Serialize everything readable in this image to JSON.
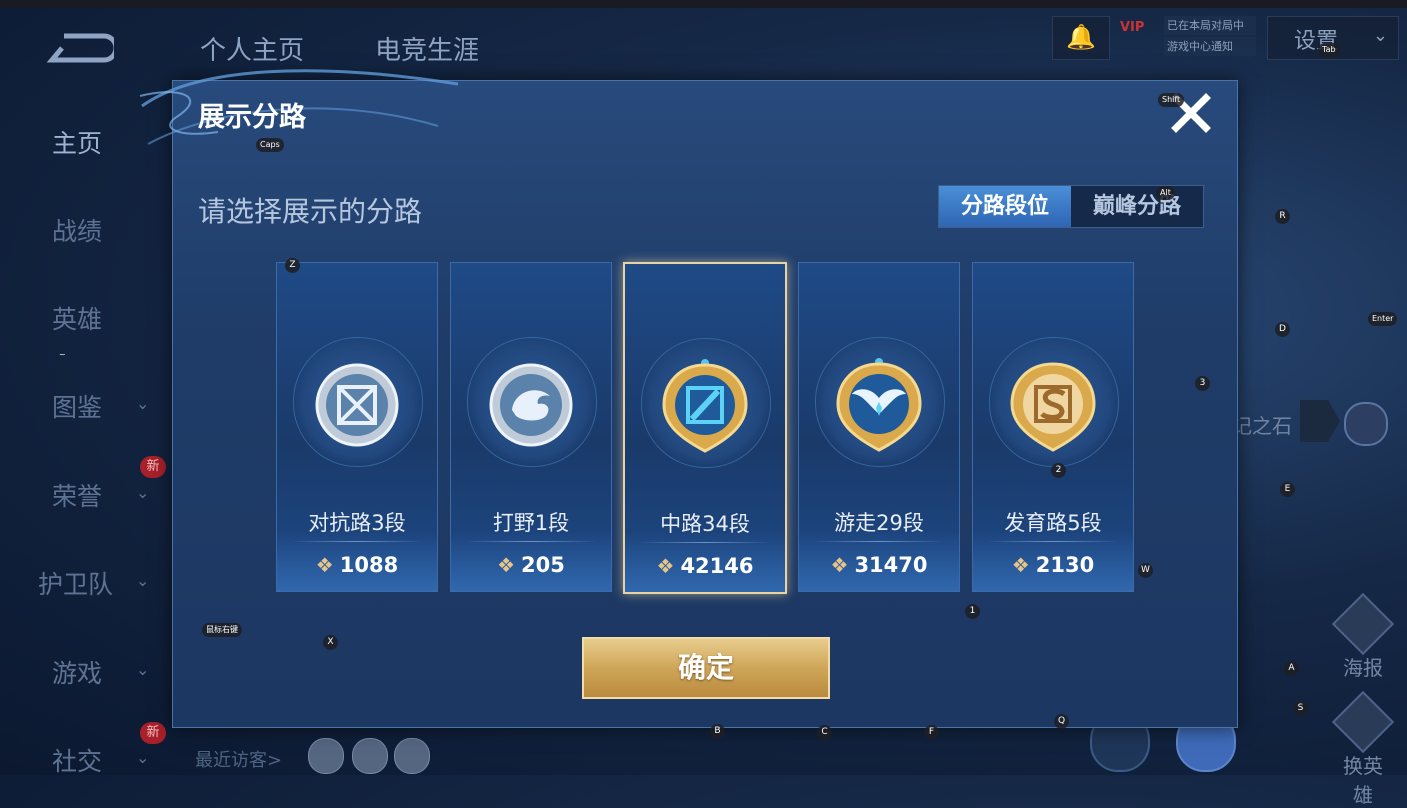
{
  "top_nav": {
    "tabs": [
      "个人主页",
      "电竞生涯"
    ],
    "settings_label": "设置",
    "vip_label": "VIP",
    "notice_lines": [
      "已在本局对局中",
      "游戏中心通知"
    ]
  },
  "sidebar": {
    "items": [
      {
        "label": "主页",
        "active": true,
        "expandable": false
      },
      {
        "label": "战绩",
        "active": false,
        "expandable": false
      },
      {
        "label": "英雄",
        "active": false,
        "expandable": false
      },
      {
        "label": "图鉴",
        "active": false,
        "expandable": true
      },
      {
        "label": "荣誉",
        "active": false,
        "expandable": true,
        "badge": "新"
      },
      {
        "label": "护卫队",
        "active": false,
        "expandable": true
      },
      {
        "label": "游戏",
        "active": false,
        "expandable": true
      },
      {
        "label": "社交",
        "active": false,
        "expandable": true,
        "badge": "新"
      }
    ],
    "recent_visitors_label": "最近访客>"
  },
  "right_panel": {
    "partial_text": "记之石",
    "poster_label": "海报",
    "change_hero_label": "换英雄"
  },
  "modal": {
    "title": "展示分路",
    "subtitle": "请选择展示的分路",
    "toggle": {
      "active": "分路段位",
      "inactive": "巅峰分路"
    },
    "cards": [
      {
        "lane": "对抗路3段",
        "score": "1088",
        "emblem": "silver-crossed-swords-emblem",
        "selected": false
      },
      {
        "lane": "打野1段",
        "score": "205",
        "emblem": "silver-dragon-emblem",
        "selected": false
      },
      {
        "lane": "中路34段",
        "score": "42146",
        "emblem": "gold-staff-emblem",
        "selected": true
      },
      {
        "lane": "游走29段",
        "score": "31470",
        "emblem": "gold-wings-emblem",
        "selected": false
      },
      {
        "lane": "发育路5段",
        "score": "2130",
        "emblem": "gold-s-emblem",
        "selected": false
      }
    ],
    "confirm_label": "确定"
  },
  "key_hints": {
    "caps": "Caps",
    "shift": "Shift",
    "tab": "Tab",
    "alt": "Alt",
    "enter": "Enter",
    "mouse_right": "鼠标右键",
    "tilde": "~",
    "z": "Z",
    "x": "X",
    "r": "R",
    "d": "D",
    "e": "E",
    "w": "W",
    "a": "A",
    "s": "S",
    "q": "Q",
    "b": "B",
    "c": "C",
    "f": "F",
    "n1": "1",
    "n2": "2",
    "n3": "3"
  },
  "colors": {
    "accent_blue": "#2e66b4",
    "gold": "#cfa658",
    "selected_border": "#e9d3a0",
    "badge_red": "#a8202a"
  }
}
